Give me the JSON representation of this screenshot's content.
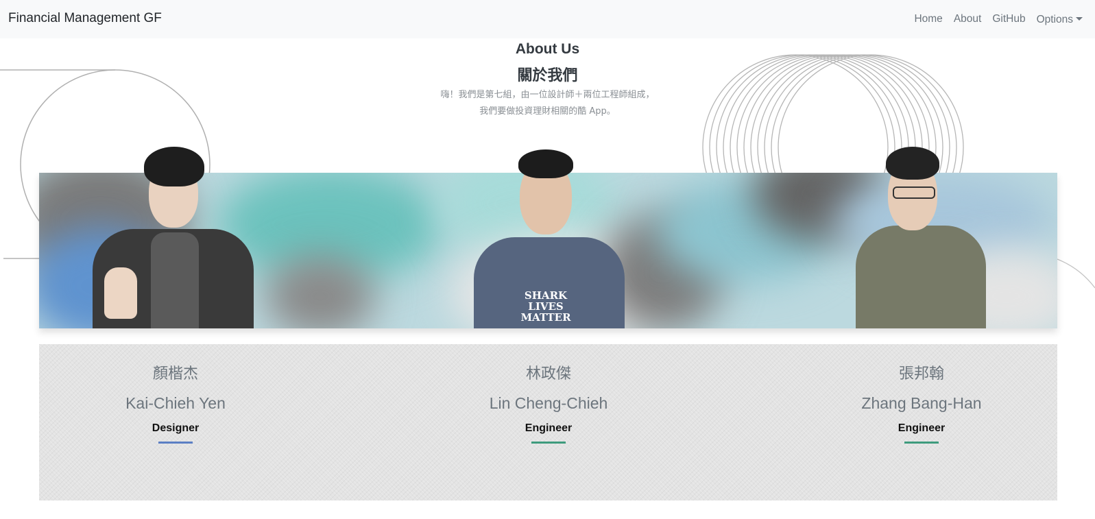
{
  "navbar": {
    "brand": "Financial Management GF",
    "links": [
      "Home",
      "About",
      "GitHub",
      "Options"
    ]
  },
  "header": {
    "title": "About Us",
    "title_zh": "關於我們",
    "intro_line1": "嗨！我們是第七組，由一位設計師＋兩位工程師組成，",
    "intro_line2": "我們要做投資理財相關的酷 App。"
  },
  "team": [
    {
      "name_zh": "顏楷杰",
      "name_en": "Kai-Chieh Yen",
      "role": "Designer",
      "accent": "#5b7fc4"
    },
    {
      "name_zh": "林政傑",
      "name_en": "Lin Cheng-Chieh",
      "role": "Engineer",
      "accent": "#3e9b7d"
    },
    {
      "name_zh": "張邦翰",
      "name_en": "Zhang Bang-Han",
      "role": "Engineer",
      "accent": "#3e9b7d"
    }
  ],
  "photo_shirt_text": "SHARK LIVES MATTER",
  "colors": {
    "navbar_bg": "#f8f9fa",
    "muted_text": "#6c757d",
    "designer_accent": "#5b7fc4",
    "engineer_accent": "#3e9b7d",
    "card_bg": "#e3e3e3"
  }
}
